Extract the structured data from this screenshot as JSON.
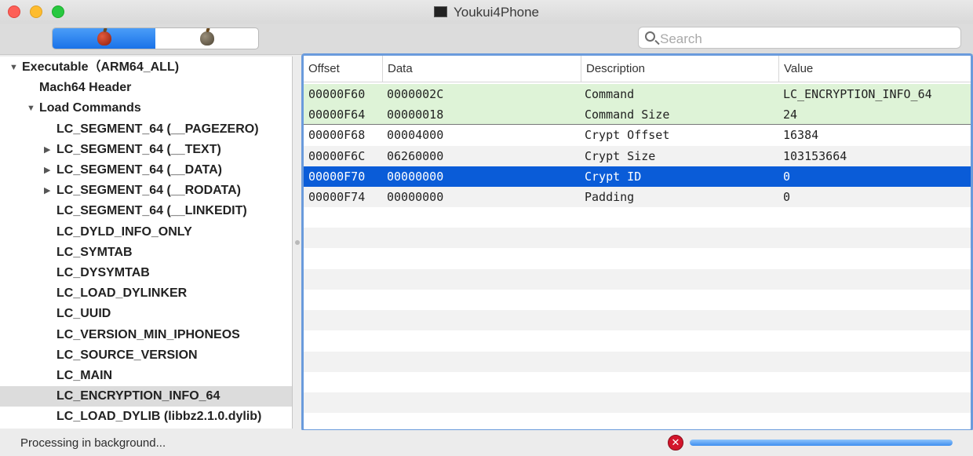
{
  "window": {
    "title": "Youkui4Phone"
  },
  "toolbar": {
    "segments": [
      {
        "icon": "red-apple-icon",
        "active": true
      },
      {
        "icon": "gray-apple-icon",
        "active": false
      }
    ],
    "search": {
      "placeholder": "Search",
      "value": ""
    }
  },
  "sidebar": {
    "items": [
      {
        "label": "Executable（ARM64_ALL)",
        "depth": 0,
        "disclosure": "expanded"
      },
      {
        "label": "Mach64 Header",
        "depth": 1,
        "disclosure": "none"
      },
      {
        "label": "Load Commands",
        "depth": 1,
        "disclosure": "expanded"
      },
      {
        "label": "LC_SEGMENT_64 (__PAGEZERO)",
        "depth": 2,
        "disclosure": "none"
      },
      {
        "label": "LC_SEGMENT_64 (__TEXT)",
        "depth": 2,
        "disclosure": "collapsed"
      },
      {
        "label": "LC_SEGMENT_64 (__DATA)",
        "depth": 2,
        "disclosure": "collapsed"
      },
      {
        "label": "LC_SEGMENT_64 (__RODATA)",
        "depth": 2,
        "disclosure": "collapsed"
      },
      {
        "label": "LC_SEGMENT_64 (__LINKEDIT)",
        "depth": 2,
        "disclosure": "none"
      },
      {
        "label": "LC_DYLD_INFO_ONLY",
        "depth": 2,
        "disclosure": "none"
      },
      {
        "label": "LC_SYMTAB",
        "depth": 2,
        "disclosure": "none"
      },
      {
        "label": "LC_DYSYMTAB",
        "depth": 2,
        "disclosure": "none"
      },
      {
        "label": "LC_LOAD_DYLINKER",
        "depth": 2,
        "disclosure": "none"
      },
      {
        "label": "LC_UUID",
        "depth": 2,
        "disclosure": "none"
      },
      {
        "label": "LC_VERSION_MIN_IPHONEOS",
        "depth": 2,
        "disclosure": "none"
      },
      {
        "label": "LC_SOURCE_VERSION",
        "depth": 2,
        "disclosure": "none"
      },
      {
        "label": "LC_MAIN",
        "depth": 2,
        "disclosure": "none"
      },
      {
        "label": "LC_ENCRYPTION_INFO_64",
        "depth": 2,
        "disclosure": "none",
        "selected": true
      },
      {
        "label": "LC_LOAD_DYLIB (libbz2.1.0.dylib)",
        "depth": 2,
        "disclosure": "none"
      }
    ]
  },
  "table": {
    "headers": [
      "Offset",
      "Data",
      "Description",
      "Value"
    ],
    "rows": [
      {
        "offset": "00000F60",
        "data": "0000002C",
        "description": "Command",
        "value": "LC_ENCRYPTION_INFO_64",
        "state": "highlight"
      },
      {
        "offset": "00000F64",
        "data": "00000018",
        "description": "Command Size",
        "value": "24",
        "state": "highlight"
      },
      {
        "offset": "00000F68",
        "data": "00004000",
        "description": "Crypt Offset",
        "value": "16384",
        "state": "normal"
      },
      {
        "offset": "00000F6C",
        "data": "06260000",
        "description": "Crypt Size",
        "value": "103153664",
        "state": "normal"
      },
      {
        "offset": "00000F70",
        "data": "00000000",
        "description": "Crypt ID",
        "value": "0",
        "state": "selected"
      },
      {
        "offset": "00000F74",
        "data": "00000000",
        "description": "Padding",
        "value": "0",
        "state": "normal"
      }
    ]
  },
  "status": {
    "text": "Processing in background...",
    "progress": 1.0
  }
}
